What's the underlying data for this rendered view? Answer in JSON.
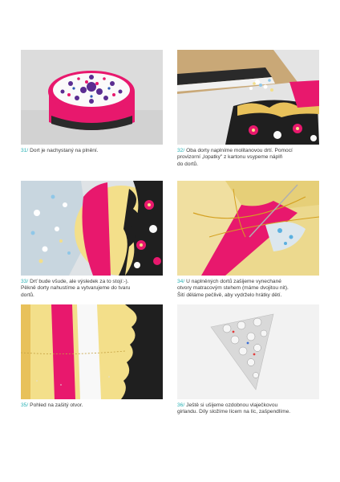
{
  "steps": [
    {
      "number": "31/",
      "text": "Dort je nachystaný na plnění."
    },
    {
      "number": "32/",
      "text": "Oba dorty naplníme molitanovou drtí. Pomocí\nprovizorní „lopatky\" z kartonu vsypeme náplň\ndo dortů."
    },
    {
      "number": "33/",
      "text": "Drť bude všude, ale výsledek za to stojí:-).\nPěkně dorty nahustíme a vytvarujeme do tvaru\ndortů."
    },
    {
      "number": "34/",
      "text": "U naplněných dortů zašijeme vynechané\notvory matracovým stehem (máme dvojitou nit).\nŠití děláme pečlivě, aby vydrželo hrátky dětí."
    },
    {
      "number": "35/",
      "text": "Pohled na zašitý otvor."
    },
    {
      "number": "36/",
      "text": "Ještě si ušijeme ozdobnou vlaječkovou\ngirlandu. Díly složíme lícem na líc, zašpendlíme."
    }
  ],
  "colors": {
    "accent": "#2bb2b5",
    "text": "#3a3a3a",
    "pink": "#e8186d",
    "yellow": "#f3df8a"
  }
}
